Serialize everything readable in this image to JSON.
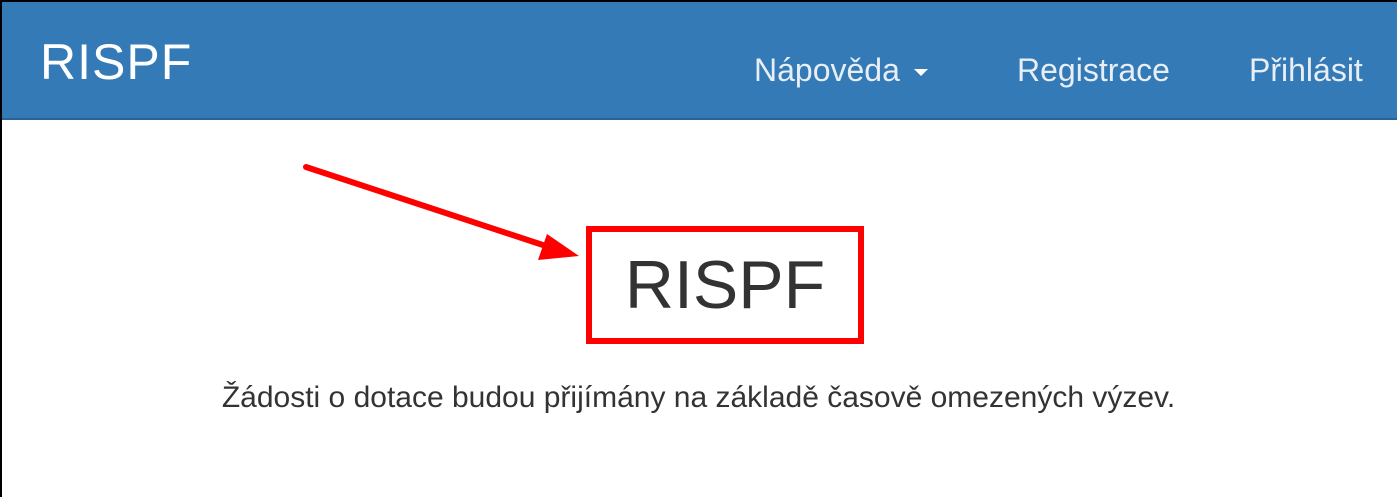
{
  "navbar": {
    "brand": "RISPF",
    "items": [
      {
        "label": "Nápověda",
        "has_dropdown": true
      },
      {
        "label": "Registrace"
      },
      {
        "label": "Přihlásit"
      }
    ],
    "color": "#337ab7"
  },
  "main": {
    "title": "RISPF",
    "subtitle": "Žádosti o dotace budou přijímány na základě časově omezených výzev.",
    "highlight_color": "#ff0000"
  }
}
